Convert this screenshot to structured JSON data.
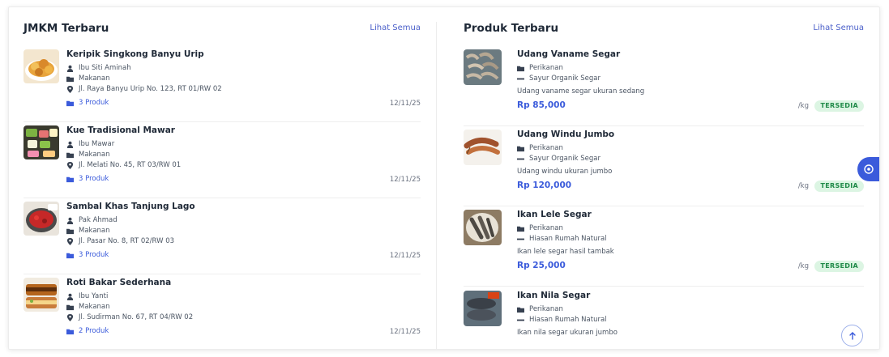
{
  "jmkm": {
    "title": "JMKM Terbaru",
    "see_all": "Lihat Semua",
    "items": [
      {
        "name": "Keripik Singkong Banyu Urip",
        "owner": "Ibu Siti Aminah",
        "category": "Makanan",
        "address": "Jl. Raya Banyu Urip No. 123, RT 01/RW 02",
        "products": "3 Produk",
        "date": "12/11/25",
        "thumb_icon": "chips-photo-icon"
      },
      {
        "name": "Kue Tradisional Mawar",
        "owner": "Ibu Mawar",
        "category": "Makanan",
        "address": "Jl. Melati No. 45, RT 03/RW 01",
        "products": "3 Produk",
        "date": "12/11/25",
        "thumb_icon": "cakes-photo-icon"
      },
      {
        "name": "Sambal Khas Tanjung Lago",
        "owner": "Pak Ahmad",
        "category": "Makanan",
        "address": "Jl. Pasar No. 8, RT 02/RW 03",
        "products": "3 Produk",
        "date": "12/11/25",
        "thumb_icon": "sambal-photo-icon"
      },
      {
        "name": "Roti Bakar Sederhana",
        "owner": "Ibu Yanti",
        "category": "Makanan",
        "address": "Jl. Sudirman No. 67, RT 04/RW 02",
        "products": "2 Produk",
        "date": "12/11/25",
        "thumb_icon": "toast-photo-icon"
      }
    ]
  },
  "produk": {
    "title": "Produk Terbaru",
    "see_all": "Lihat Semua",
    "items": [
      {
        "name": "Udang Vaname Segar",
        "category": "Perikanan",
        "store": "Sayur Organik Segar",
        "desc": "Udang vaname segar ukuran sedang",
        "price": "Rp 85,000",
        "unit": "/kg",
        "status": "TERSEDIA",
        "thumb_icon": "shrimp-photo-icon"
      },
      {
        "name": "Udang Windu Jumbo",
        "category": "Perikanan",
        "store": "Sayur Organik Segar",
        "desc": "Udang windu ukuran jumbo",
        "price": "Rp 120,000",
        "unit": "/kg",
        "status": "TERSEDIA",
        "thumb_icon": "tiger-prawn-photo-icon"
      },
      {
        "name": "Ikan Lele Segar",
        "category": "Perikanan",
        "store": "Hiasan Rumah Natural",
        "desc": "Ikan lele segar hasil tambak",
        "price": "Rp 25,000",
        "unit": "/kg",
        "status": "TERSEDIA",
        "thumb_icon": "catfish-photo-icon"
      },
      {
        "name": "Ikan Nila Segar",
        "category": "Perikanan",
        "store": "Hiasan Rumah Natural",
        "desc": "Ikan nila segar ukuran jumbo",
        "thumb_icon": "tilapia-photo-icon"
      }
    ]
  },
  "colors": {
    "accent": "#3b5bdb",
    "badge_bg": "#dcf5e3",
    "badge_text": "#1f8a48"
  }
}
